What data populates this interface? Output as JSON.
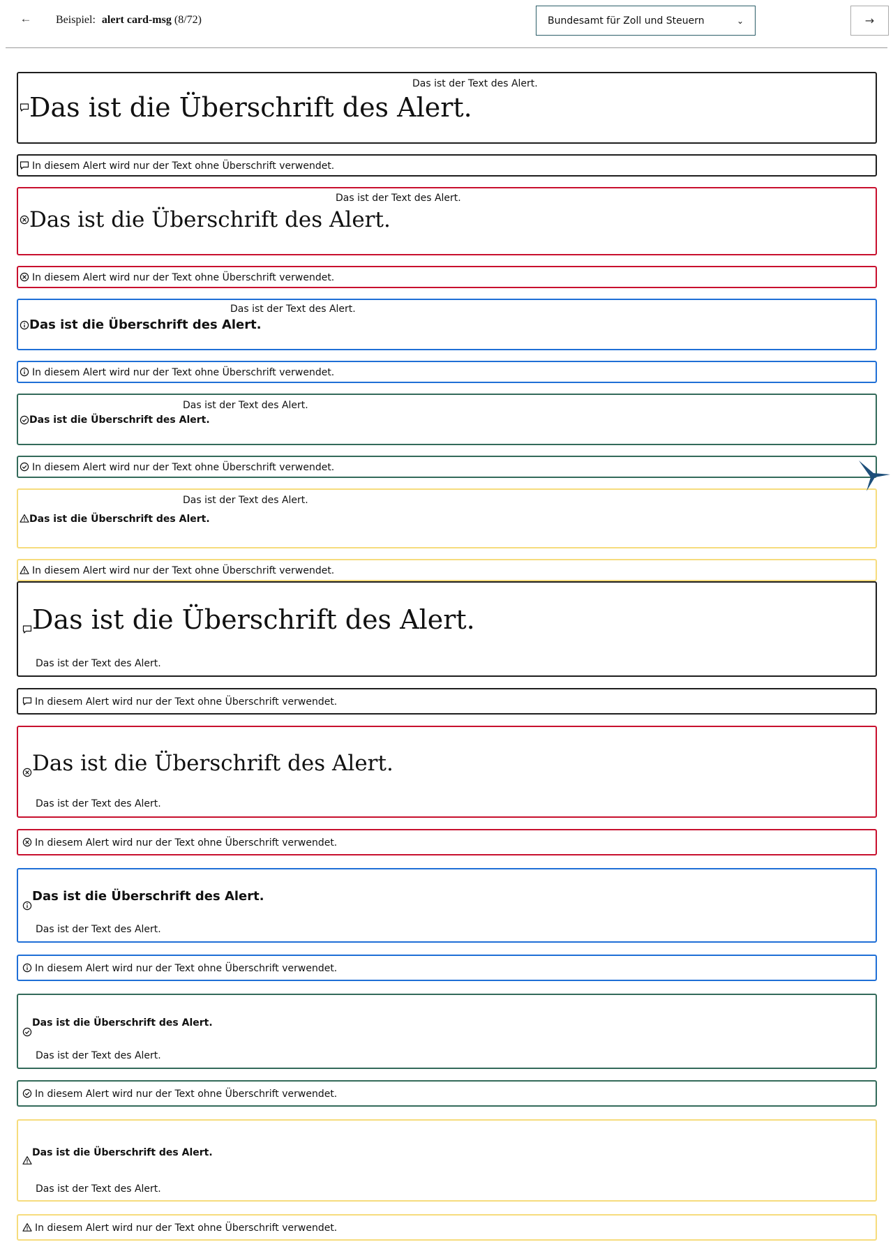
{
  "header": {
    "back_icon": "arrow-left-icon",
    "example_label": "Beispiel:",
    "example_name": "alert card-msg",
    "example_count": "(8/72)",
    "organisation_selected": "Bundesamt für Zoll und Steuern",
    "next_icon": "arrow-right-icon"
  },
  "alerts": {
    "heading": "Das ist die Überschrift des Alert.",
    "text": "Das ist der Text des Alert.",
    "text_only": "In diesem Alert wird nur der Text ohne Überschrift verwendet."
  },
  "colors": {
    "default": "#1e1e1e",
    "error": "#c8102e",
    "info": "#1f6fd6",
    "success": "#336a5a",
    "warning": "#f6dc7d",
    "brand": "#1d4f7a"
  },
  "icons": {
    "default": "speech-bubble-icon",
    "error": "circle-x-icon",
    "info": "circle-info-icon",
    "success": "circle-check-icon",
    "warning": "warning-triangle-icon",
    "brand": "bird-logo-icon"
  }
}
